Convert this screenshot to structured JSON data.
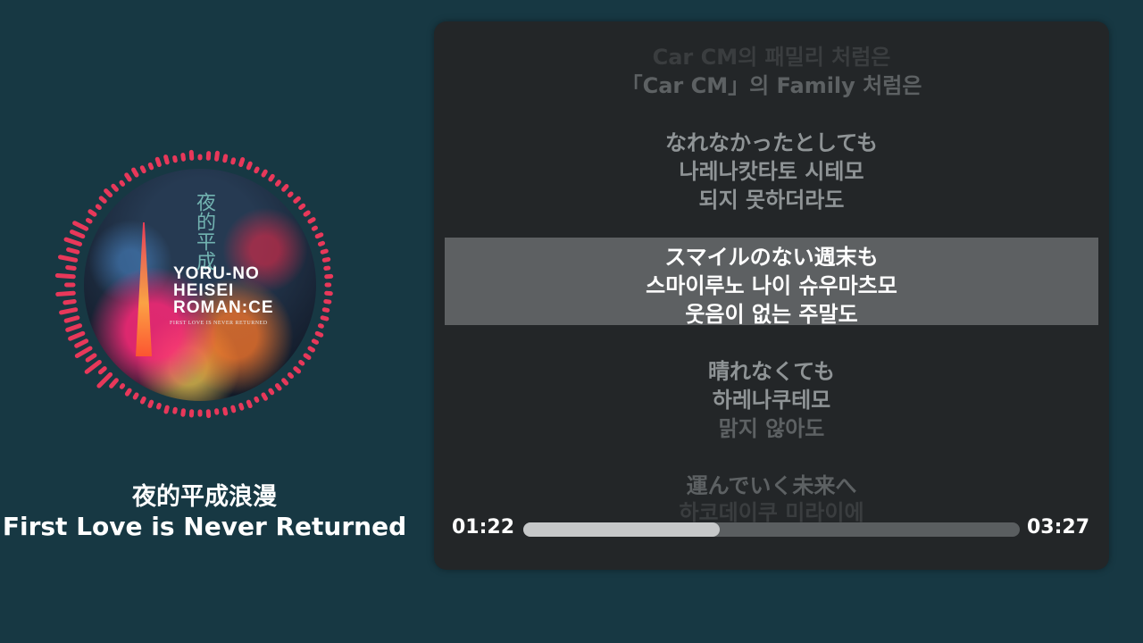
{
  "album": {
    "art_kanji": "夜的平成",
    "logo_line1": "YORU-NO",
    "logo_line2": "HEISEI",
    "logo_line3": "ROMAN:CE",
    "logo_sub": "FIRST LOVE IS NEVER RETURNED",
    "visualizer_color": "#e8385a"
  },
  "song": {
    "title": "夜的平成浪漫",
    "subtitle": "First Love is Never Returned"
  },
  "lyrics": {
    "lines": [
      {
        "text": "Car CM의 패밀리 처럼은",
        "tone": "faint"
      },
      {
        "text": "「Car CM」의 Family 처럼은",
        "tone": "dim"
      },
      {
        "text": "なれなかったとしても",
        "tone": "mid"
      },
      {
        "text": "나레나캇타토 시테모",
        "tone": "mid"
      },
      {
        "text": "되지 못하더라도",
        "tone": "mid"
      },
      {
        "text": "スマイルのない週末も",
        "tone": "bright"
      },
      {
        "text": "스마이루노 나이 슈우마츠모",
        "tone": "bright"
      },
      {
        "text": "웃음이 없는 주말도",
        "tone": "bright"
      },
      {
        "text": "晴れなくても",
        "tone": "mid"
      },
      {
        "text": "하레나쿠테모",
        "tone": "mid"
      },
      {
        "text": "맑지 않아도",
        "tone": "dim"
      },
      {
        "text": "運んでいく未来へ",
        "tone": "dim"
      },
      {
        "text": "하코데이쿠 미라이에",
        "tone": "faint"
      }
    ]
  },
  "player": {
    "current_time": "01:22",
    "total_time": "03:27",
    "progress": 0.396
  },
  "colors": {
    "background": "#173843",
    "panel": "#232628",
    "highlight": "#5d6062",
    "accent": "#e8385a"
  }
}
